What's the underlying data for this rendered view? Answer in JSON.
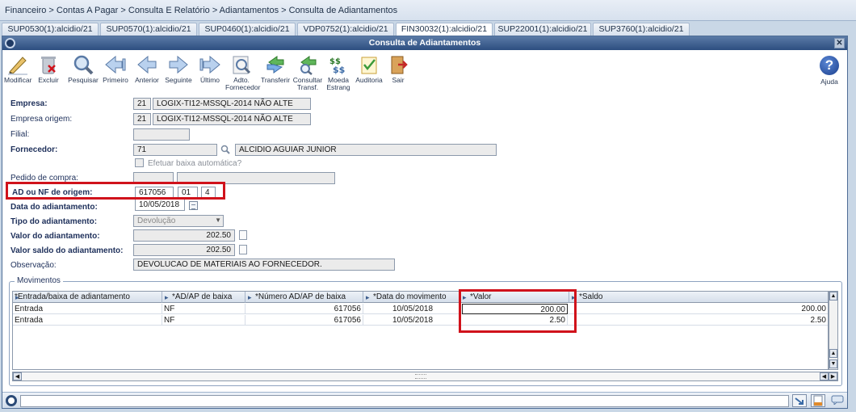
{
  "breadcrumb": "Financeiro > Contas A Pagar > Consulta E Relatório > Adiantamentos > Consulta de Adiantamentos",
  "tabs": [
    "SUP0530(1):alcidio/21",
    "SUP0570(1):alcidio/21",
    "SUP0460(1):alcidio/21",
    "VDP0752(1):alcidio/21",
    "FIN30032(1):alcidio/21",
    "SUP22001(1):alcidio/21",
    "SUP3760(1):alcidio/21"
  ],
  "window": {
    "title": "Consulta de Adiantamentos",
    "close": "✕"
  },
  "toolbar": {
    "modificar": "Modificar",
    "excluir": "Excluir",
    "pesquisar": "Pesquisar",
    "primeiro": "Primeiro",
    "anterior": "Anterior",
    "seguinte": "Seguinte",
    "ultimo": "Último",
    "adto_1": "Adto.",
    "adto_2": "Fornecedor",
    "transferir": "Transferir",
    "consultar_1": "Consultar",
    "consultar_2": "Transf.",
    "moeda_1": "Moeda",
    "moeda_2": "Estrang",
    "auditoria": "Auditoria",
    "sair": "Sair",
    "ajuda": "Ajuda",
    "ajuda_glyph": "?"
  },
  "form": {
    "empresa": {
      "label": "Empresa:",
      "code": "21",
      "name": "LOGIX-TI12-MSSQL-2014 NÃO ALTE"
    },
    "empresa_origem": {
      "label": "Empresa origem:",
      "code": "21",
      "name": "LOGIX-TI12-MSSQL-2014 NÃO ALTE"
    },
    "filial": {
      "label": "Filial:",
      "value": ""
    },
    "fornecedor": {
      "label": "Fornecedor:",
      "code": "71",
      "name": "ALCIDIO AGUIAR JUNIOR"
    },
    "baixa_automatica": {
      "label": "Efetuar baixa automática?",
      "checked": false
    },
    "pedido_compra": {
      "label": "Pedido de compra:",
      "value": ""
    },
    "ad_nf_origem": {
      "label": "AD ou NF de origem:",
      "number": "617056",
      "serie": "01",
      "sub": "4"
    },
    "data_adiantamento": {
      "label": "Data do adiantamento:",
      "value": "10/05/2018"
    },
    "tipo_adiantamento": {
      "label": "Tipo do adiantamento:",
      "value": "Devolução"
    },
    "valor_adiantamento": {
      "label": "Valor do adiantamento:",
      "value": "202.50"
    },
    "valor_saldo": {
      "label": "Valor saldo do adiantamento:",
      "value": "202.50"
    },
    "observacao": {
      "label": "Observação:",
      "value": "DEVOLUCAO DE MATERIAIS AO FORNECEDOR."
    }
  },
  "movimentos": {
    "title": "Movimentos",
    "columns": [
      "*Entrada/baixa de adiantamento",
      "*AD/AP de baixa",
      "*Número AD/AP de baixa",
      "*Data do movimento",
      "*Valor",
      "*Saldo"
    ],
    "rows": [
      [
        "Entrada",
        "NF",
        "617056",
        "10/05/2018",
        "200.00",
        "200.00"
      ],
      [
        "Entrada",
        "NF",
        "617056",
        "10/05/2018",
        "2.50",
        "2.50"
      ]
    ]
  },
  "colors": {
    "titlebar": "#2d4e80",
    "highlight": "#d0121b"
  }
}
